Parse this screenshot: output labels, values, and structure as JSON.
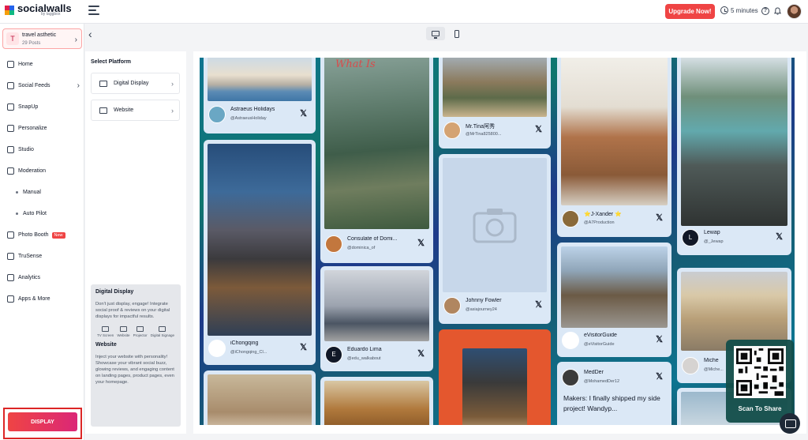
{
  "topbar": {
    "brand": "socialwalls",
    "brand_sub": "by taggbox",
    "upgrade_label": "Upgrade Now!",
    "timer_label": "5 minutes",
    "help_symbol": "?"
  },
  "sidebar": {
    "wall": {
      "initial": "T",
      "name": "travel asthetic",
      "count": "29 Posts"
    },
    "items": [
      {
        "label": "Home",
        "icon": "home-icon"
      },
      {
        "label": "Social Feeds",
        "icon": "feeds-icon"
      },
      {
        "label": "SnapUp",
        "icon": "snapup-icon"
      },
      {
        "label": "Personalize",
        "icon": "personalize-icon"
      },
      {
        "label": "Studio",
        "icon": "studio-icon"
      },
      {
        "label": "Moderation",
        "icon": "moderation-icon"
      },
      {
        "label": "Manual",
        "icon": ""
      },
      {
        "label": "Auto Pilot",
        "icon": ""
      },
      {
        "label": "Photo Booth",
        "icon": "camera-icon",
        "badge": "New"
      },
      {
        "label": "TruSense",
        "icon": "trusense-icon"
      },
      {
        "label": "Analytics",
        "icon": "analytics-icon"
      },
      {
        "label": "Apps & More",
        "icon": "apps-icon"
      }
    ],
    "display_label": "DISPLAY"
  },
  "settings": {
    "title": "Select Platform",
    "platforms": [
      "Digital Display",
      "Website"
    ],
    "info": {
      "digital_title": "Digital Display",
      "digital_text": "Don't just display, engage! Integrate social proof & reviews on your digital displays for impactful results.",
      "devices": [
        "TV Screen",
        "Website",
        "Projector",
        "Digital Signage"
      ],
      "website_title": "Website",
      "website_text": "Inject your website with personality! Showcase your vibrant social buzz, glowing reviews, and engaging content on landing pages, product pages, even your homepage."
    }
  },
  "posts": [
    {
      "name": "Astraeus Holidays",
      "handle": "@AstraeusHoliday"
    },
    {
      "name": "iChongqing",
      "handle": "@iChongqing_Cl..."
    },
    {
      "name": "Consulate of Domi...",
      "handle": "@dominica_of"
    },
    {
      "name": "Eduardo Lima",
      "handle": "@edu_walkabout"
    },
    {
      "name": "Mr.Tina阿秀",
      "handle": "@MrTina825800..."
    },
    {
      "name": "Johnny Fowler",
      "handle": "@asiajourney24"
    },
    {
      "name": "⭐J-Xander ⭐",
      "handle": "@A7Production"
    },
    {
      "name": "eVisitorGuide",
      "handle": "@eVisitorGuide"
    },
    {
      "name": "MedDer",
      "handle": "@MohamedDer12"
    },
    {
      "name": "Lewap",
      "handle": "@_Jewap"
    },
    {
      "name": "Miche",
      "handle": "@Miche..."
    }
  ],
  "post_overlay_text": "What Is",
  "post_text": "Makers: I finally shipped my side project! Wandyp...",
  "qr_label": "Scan To Share",
  "colors": {
    "accent": "#ef4444",
    "wall_card": "#dbe8f6"
  }
}
